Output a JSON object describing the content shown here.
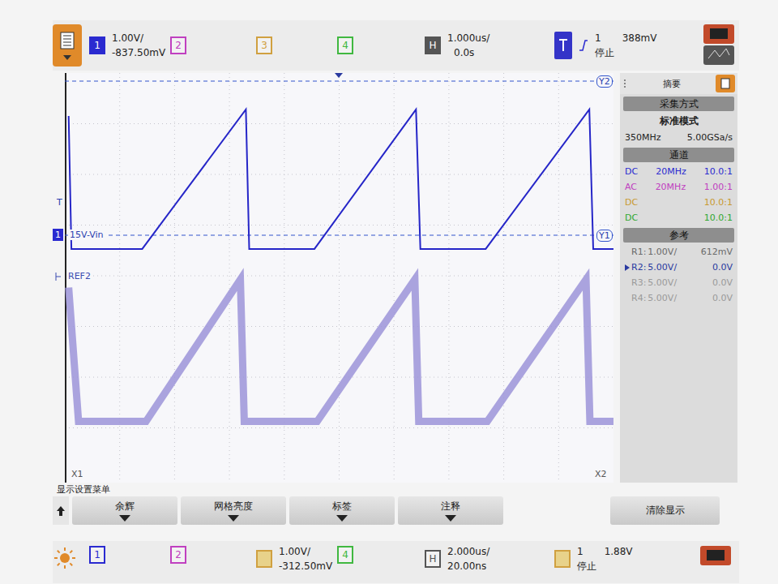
{
  "top_bar": {
    "channels": [
      {
        "label": "1",
        "color": "#2a2ad0",
        "active": true,
        "scale": "1.00V/",
        "offset": "-837.50mV"
      },
      {
        "label": "2",
        "color": "#c040c0",
        "active": false
      },
      {
        "label": "3",
        "color": "#d0a040",
        "active": false
      },
      {
        "label": "4",
        "color": "#40b840",
        "active": false
      }
    ],
    "horizontal": {
      "label": "H",
      "scale": "1.000us/",
      "delay": "0.0s"
    },
    "trigger": {
      "source": "1",
      "level": "388mV",
      "status": "停止"
    }
  },
  "plot": {
    "labels": {
      "y1": "Y1",
      "y2": "Y2",
      "x1": "X1",
      "x2": "X2",
      "trigger_marker": "T",
      "ch1_marker": "1",
      "ref_marker": "REF2",
      "annotation": "15V-Vin"
    },
    "series": [
      {
        "name": "REF2",
        "color": "#9c94d8",
        "points": [
          [
            0.07,
            -1.0
          ],
          [
            0.25,
            -14.2
          ],
          [
            1.48,
            -14.2
          ],
          [
            3.2,
            -0.2
          ],
          [
            3.27,
            -14.2
          ],
          [
            4.6,
            -14.2
          ],
          [
            6.38,
            -0.2
          ],
          [
            6.45,
            -14.2
          ],
          [
            7.7,
            -14.2
          ],
          [
            9.5,
            -0.2
          ],
          [
            9.57,
            -14.2
          ],
          [
            10,
            -14.2
          ]
        ]
      },
      {
        "name": "CH1",
        "color": "#2626c8",
        "points": [
          [
            0.07,
            2.35
          ],
          [
            0.12,
            -0.27
          ],
          [
            1.41,
            -0.27
          ],
          [
            3.3,
            2.48
          ],
          [
            3.36,
            -0.27
          ],
          [
            4.55,
            -0.27
          ],
          [
            6.4,
            2.48
          ],
          [
            6.48,
            -0.27
          ],
          [
            7.67,
            -0.27
          ],
          [
            9.56,
            2.48
          ],
          [
            9.63,
            -0.27
          ],
          [
            10,
            -0.27
          ]
        ]
      }
    ]
  },
  "side_panel": {
    "title": "摘要",
    "acquisition": {
      "title": "采集方式",
      "mode": "标准模式",
      "bandwidth": "350MHz",
      "sample_rate": "5.00GSa/s"
    },
    "channels": {
      "title": "通道",
      "rows": [
        {
          "coupling": "DC",
          "bw": "20MHz",
          "probe": "10.0:1",
          "color": "#2a2ad0"
        },
        {
          "coupling": "AC",
          "bw": "20MHz",
          "probe": "1.00:1",
          "color": "#c040c0"
        },
        {
          "coupling": "DC",
          "probe": "10.0:1",
          "color": "#c89a30"
        },
        {
          "coupling": "DC",
          "probe": "10.0:1",
          "color": "#30a830"
        }
      ]
    },
    "references": {
      "title": "参考",
      "rows": [
        {
          "name": "R1:",
          "scale": "1.00V/",
          "offset": "612mV",
          "selected": false,
          "enabled": true
        },
        {
          "name": "R2:",
          "scale": "5.00V/",
          "offset": "0.0V",
          "selected": true,
          "enabled": true
        },
        {
          "name": "R3:",
          "scale": "5.00V/",
          "offset": "0.0V",
          "selected": false,
          "enabled": false
        },
        {
          "name": "R4:",
          "scale": "5.00V/",
          "offset": "0.0V",
          "selected": false,
          "enabled": false
        }
      ]
    }
  },
  "menu": {
    "title": "显示设置菜单",
    "buttons": [
      "余辉",
      "网格亮度",
      "标签",
      "注释"
    ],
    "clear": "清除显示"
  },
  "bottom_bar": {
    "ch1": "1",
    "ch2": "2",
    "scale": "1.00V/",
    "offset": "-312.50mV",
    "ch4": "4",
    "h": "H",
    "time_scale": "2.000us/",
    "delay": "20.00ns",
    "trigger_source": "1",
    "trigger_level": "1.88V",
    "status": "停止"
  }
}
